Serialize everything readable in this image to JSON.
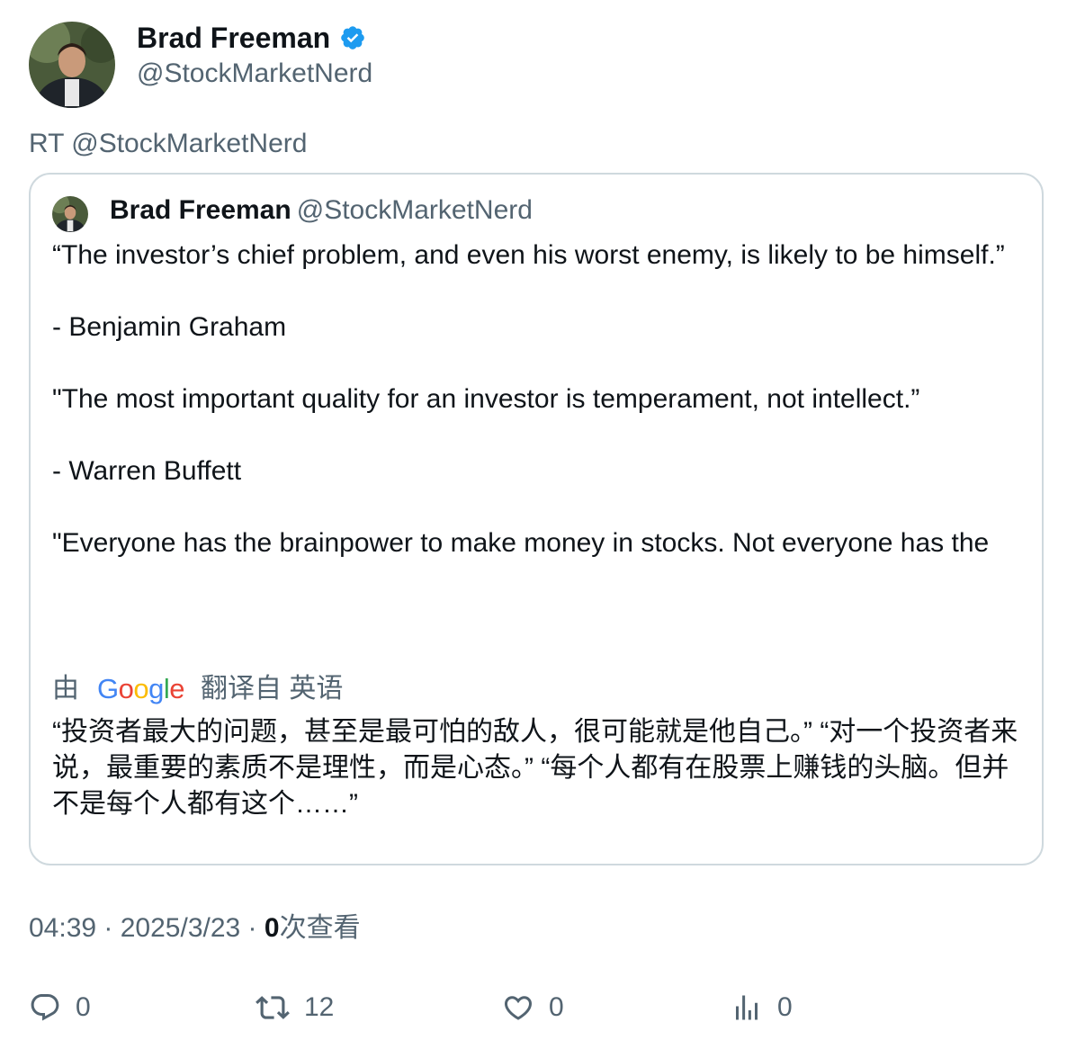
{
  "author": {
    "display_name": "Brad Freeman",
    "handle": "@StockMarketNerd",
    "verified": true
  },
  "retweet_label": "RT @StockMarketNerd",
  "quote": {
    "display_name": "Brad Freeman",
    "handle": "@StockMarketNerd",
    "paragraphs": [
      "“The investor’s chief problem, and even his worst enemy, is likely to be himself.”",
      "- Benjamin Graham",
      "\"The most important quality for an investor is temperament, not intellect.”",
      "- Warren Buffett",
      "\"Everyone has the brainpower to make money in stocks. Not everyone has the"
    ],
    "translation": {
      "prefix": "由",
      "brand": "Google",
      "suffix": "翻译自 英语",
      "text": "“投资者最大的问题，甚至是最可怕的敌人，很可能就是他自己。” “对一个投资者来说，最重要的素质不是理性，而是心态。” “每个人都有在股票上赚钱的头脑。但并不是每个人都有这个……”"
    }
  },
  "meta": {
    "time": "04:39",
    "separator": " · ",
    "date": "2025/3/23",
    "views_count": "0",
    "views_label": "次查看"
  },
  "actions": {
    "replies": "0",
    "retweets": "12",
    "likes": "0",
    "views": "0"
  },
  "colors": {
    "verified": "#1d9bf0",
    "secondary_text": "#536471",
    "border": "#cfd9de"
  },
  "icons": [
    "verified-badge-icon",
    "reply-icon",
    "retweet-icon",
    "like-icon",
    "views-icon"
  ]
}
